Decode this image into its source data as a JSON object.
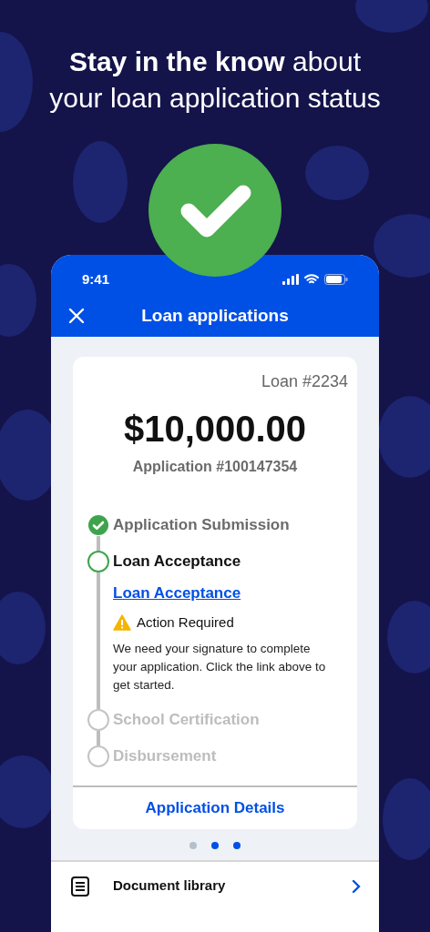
{
  "headline": "**Stay in the know** about your loan application status",
  "status_bar": {
    "time": "9:41"
  },
  "header": {
    "title": "Loan applications"
  },
  "loan": {
    "number": "Loan #2234",
    "amount": "$10,000.00",
    "application": "Application #100147354"
  },
  "steps": [
    {
      "label": "Application Submission",
      "kind": "done"
    },
    {
      "label": "Loan Acceptance",
      "kind": "current",
      "link": "Loan Acceptance",
      "alert": "Action Required",
      "message": "We need your signature to complete your application. Click the link above to get started."
    },
    {
      "label": "School Certification",
      "kind": "pending"
    },
    {
      "label": "Disbursement",
      "kind": "pending"
    }
  ],
  "details_link": "Application Details",
  "page_dots": [
    {
      "color": "#b4bfcc"
    },
    {
      "color": "#0050e6"
    },
    {
      "color": "#0050e6"
    }
  ],
  "menu": [
    {
      "label": "Document library"
    }
  ]
}
